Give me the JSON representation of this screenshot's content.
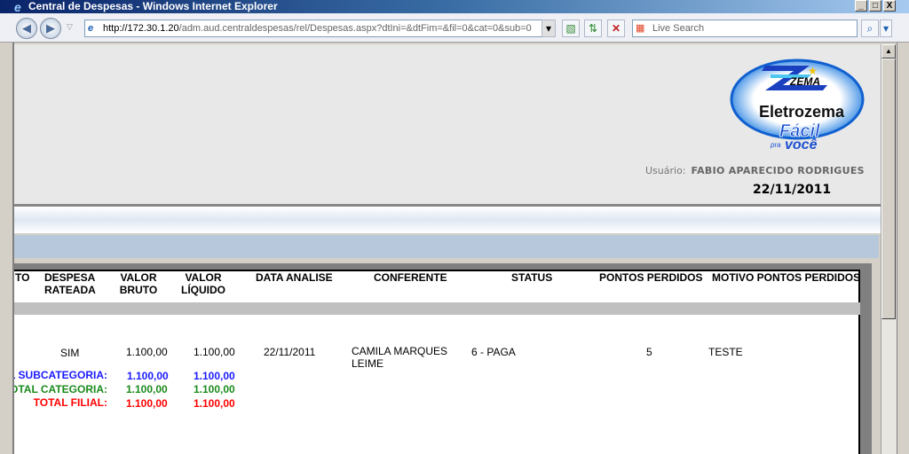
{
  "window": {
    "title": "Central de Despesas - Windows Internet Explorer",
    "minimize": "_",
    "maximize": "□",
    "close": "X"
  },
  "toolbar": {
    "back": "◀",
    "forward": "▶",
    "url_host": "http://172.30.1.20",
    "url_path": "/adm.aud.centraldespesas/rel/Despesas.aspx?dtIni=&dtFim=&fil=0&cat=0&sub=0",
    "search_placeholder": "Live Search",
    "search_icon": "magnifier-icon",
    "refresh_icon": "refresh-icon",
    "stop_icon": "stop-icon",
    "compat_icon": "compatibility-icon"
  },
  "header": {
    "logo_brand": "ZEMA",
    "logo_name": "Eletrozema",
    "logo_slogan": "Fácil pra você",
    "user_label": "Usuário:",
    "user_name": "FABIO APARECIDO RODRIGUES",
    "date": "22/11/2011"
  },
  "table": {
    "columns": [
      "TO",
      "DESPESA RATEADA",
      "VALOR BRUTO",
      "VALOR LÍQUIDO",
      "DATA ANALISE",
      "CONFERENTE",
      "STATUS",
      "PONTOS PERDIDOS",
      "MOTIVO PONTOS PERDIDOS"
    ],
    "col_lines": {
      "c1a": "DESPESA",
      "c1b": "RATEADA",
      "c2a": "VALOR",
      "c2b": "BRUTO",
      "c3a": "VALOR",
      "c3b": "LÍQUIDO"
    },
    "rows": [
      {
        "rateada": "SIM",
        "bruto": "1.100,00",
        "liquido": "1.100,00",
        "data": "22/11/2011",
        "conferente_l1": "CAMILA MARQUES",
        "conferente_l2": "LEIME",
        "status": "6 - PAGA",
        "pontos": "5",
        "motivo": "TESTE"
      }
    ],
    "totals": [
      {
        "label": "TOTAL SUBCATEGORIA:",
        "bruto": "1.100,00",
        "liquido": "1.100,00",
        "color": "#1a1aff"
      },
      {
        "label": "TOTAL CATEGORIA:",
        "bruto": "1.100,00",
        "liquido": "1.100,00",
        "color": "#1a8a1a"
      },
      {
        "label": "TOTAL FILIAL:",
        "bruto": "1.100,00",
        "liquido": "1.100,00",
        "color": "#ff0000"
      }
    ]
  }
}
